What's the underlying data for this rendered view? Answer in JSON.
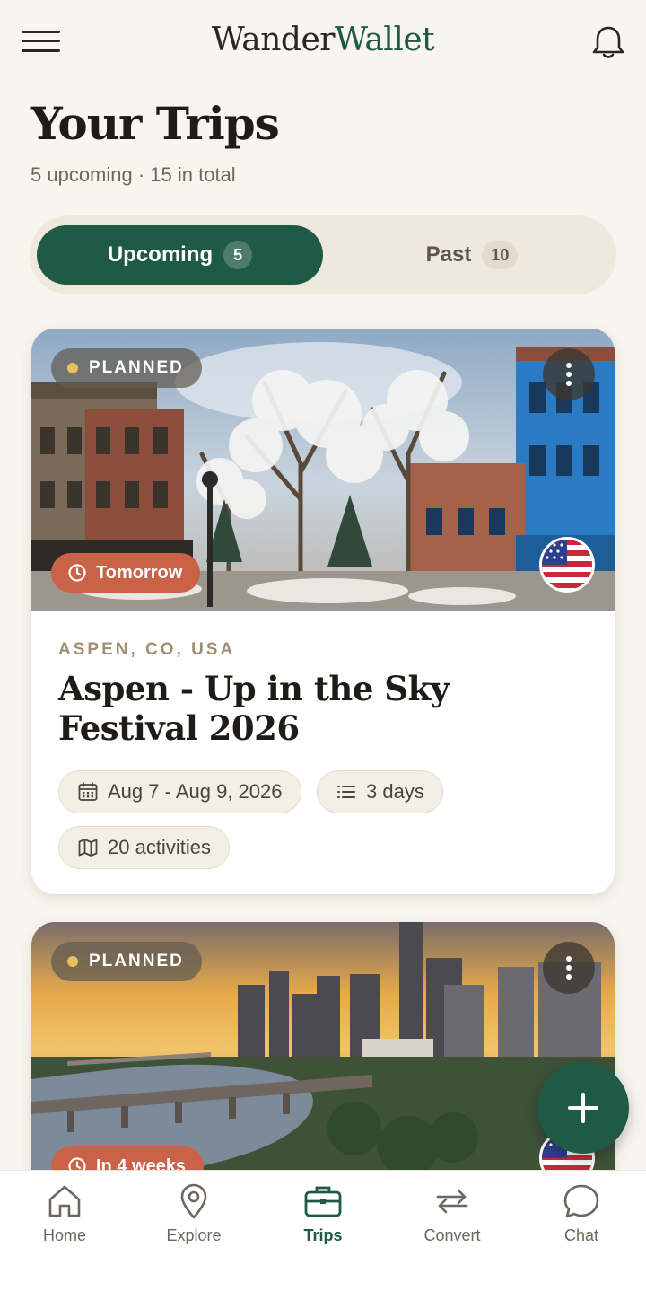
{
  "header": {
    "brand_part1": "Wander",
    "brand_part2": "Wallet",
    "menu_icon": "menu-icon",
    "bell_icon": "bell-icon"
  },
  "page": {
    "title": "Your Trips",
    "subtitle": "5 upcoming · 15 in total"
  },
  "tabs": [
    {
      "label": "Upcoming",
      "count": "5",
      "selected": true
    },
    {
      "label": "Past",
      "count": "10",
      "selected": false
    }
  ],
  "trips": [
    {
      "status": "PLANNED",
      "countdown": "Tomorrow",
      "location": "ASPEN, CO, USA",
      "title": "Aspen - Up in the Sky Festival 2026",
      "dates": "Aug 7 - Aug 9, 2026",
      "duration": "3 days",
      "activities": "20 activities",
      "flag": "us-flag-icon"
    },
    {
      "status": "PLANNED",
      "countdown": "In 4 weeks",
      "flag": "us-flag-icon"
    }
  ],
  "nav": [
    {
      "label": "Home",
      "icon": "home-icon",
      "active": false
    },
    {
      "label": "Explore",
      "icon": "map-pin-icon",
      "active": false
    },
    {
      "label": "Trips",
      "icon": "briefcase-icon",
      "active": true
    },
    {
      "label": "Convert",
      "icon": "swap-icon",
      "active": false
    },
    {
      "label": "Chat",
      "icon": "chat-icon",
      "active": false
    }
  ],
  "colors": {
    "brand_green": "#1f5a47",
    "background": "#f8f5ef",
    "countdown_orange": "#c96247",
    "status_dot": "#e9c15b"
  }
}
